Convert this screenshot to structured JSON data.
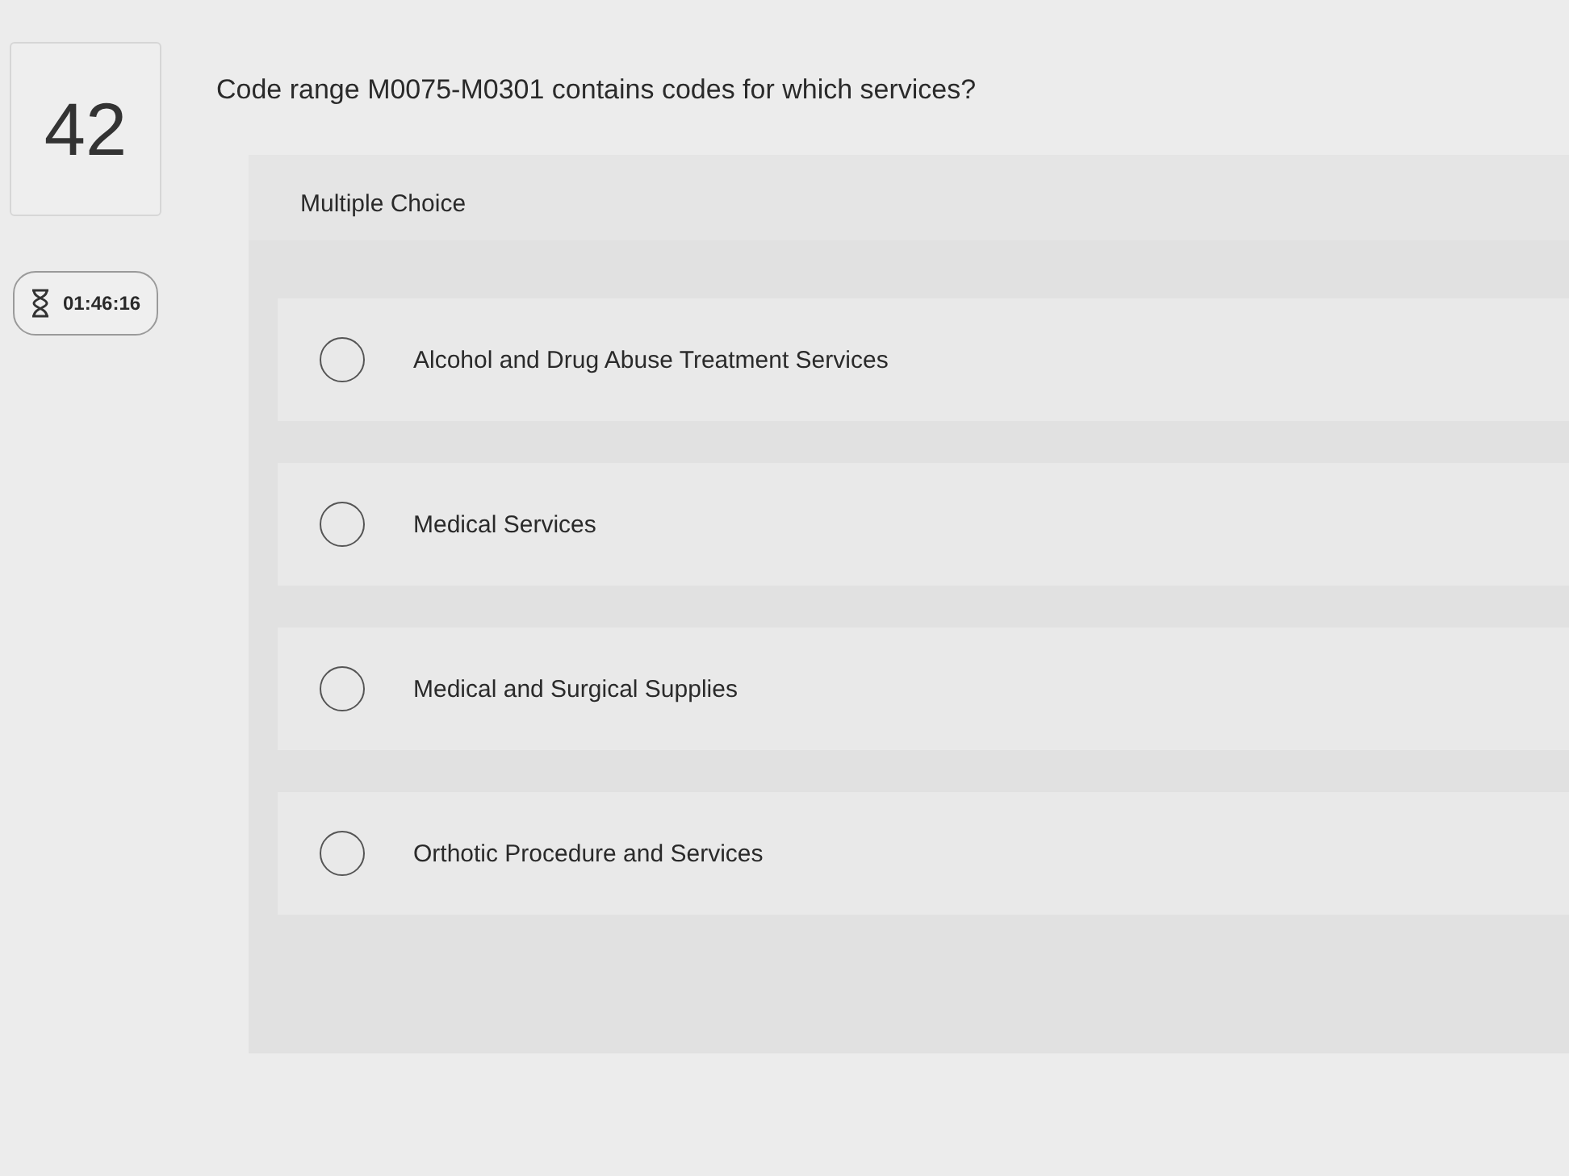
{
  "question": {
    "number": "42",
    "text": "Code range M0075-M0301 contains codes for which services?"
  },
  "timer": {
    "time": "01:46:16"
  },
  "answer_panel": {
    "type_label": "Multiple Choice",
    "options": [
      {
        "label": "Alcohol and Drug Abuse Treatment Services",
        "selected": false
      },
      {
        "label": "Medical Services",
        "selected": false
      },
      {
        "label": "Medical and Surgical Supplies",
        "selected": false
      },
      {
        "label": "Orthotic Procedure and Services",
        "selected": false
      }
    ]
  }
}
